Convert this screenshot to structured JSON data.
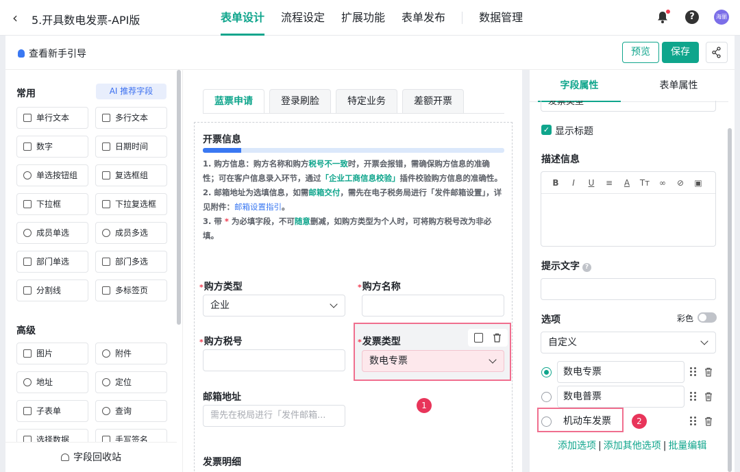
{
  "header": {
    "back_glyph": "‹",
    "title": "5.开具数电发票-API版",
    "tabs": [
      {
        "label": "表单设计",
        "active": true
      },
      {
        "label": "流程设定",
        "active": false
      },
      {
        "label": "扩展功能",
        "active": false
      },
      {
        "label": "表单发布",
        "active": false
      },
      {
        "label": "数据管理",
        "active": false
      }
    ],
    "help_glyph": "?",
    "avatar_text": "海丽"
  },
  "toolbar": {
    "guide_label": "查看新手引导",
    "preview_label": "预览",
    "save_label": "保存"
  },
  "left": {
    "common_title": "常用",
    "ai_label": "AI 推荐字段",
    "common_fields": [
      "单行文本",
      "多行文本",
      "数字",
      "日期时间",
      "单选按钮组",
      "复选框组",
      "下拉框",
      "下拉复选框",
      "成员单选",
      "成员多选",
      "部门单选",
      "部门多选",
      "分割线",
      "多标签页"
    ],
    "advanced_title": "高级",
    "advanced_fields": [
      "图片",
      "附件",
      "地址",
      "定位",
      "子表单",
      "查询",
      "选择数据",
      "手写签名"
    ],
    "recycle_label": "字段回收站"
  },
  "canvas": {
    "tabs": [
      "蓝票申请",
      "登录刷脸",
      "特定业务",
      "差额开票"
    ],
    "section_title": "开票信息",
    "info": {
      "l1a": "1. 购方信息：购方名称和购方",
      "l1b": "税号不一致",
      "l1c": "时，开票会报错，需确保购方信息的准确性；可在客户信息录入环节，通过",
      "l1d": "「企业工商信息校验」",
      "l1e": "插件校验购方信息的准确性。",
      "l2a": "2. 邮箱地址为选填信息，如需",
      "l2b": "邮箱交付",
      "l2c": "，需先在电子税务局进行「发件邮箱设置」，详见附件：",
      "l2d": "邮箱设置指引",
      "l2e": "。",
      "l3a": "3. 带",
      "l3b": " * ",
      "l3c": "为必填字段，不可",
      "l3d": "随意",
      "l3e": "删减，如购方类型为个人时，可将购方税号改为非必填。"
    },
    "required_mark": "*",
    "buyer_type_label": "购方类型",
    "buyer_type_value": "企业",
    "buyer_name_label": "购方名称",
    "buyer_tax_label": "购方税号",
    "invoice_type_label": "发票类型",
    "invoice_type_value": "数电专票",
    "email_label": "邮箱地址",
    "email_placeholder": "需先在税局进行「发件邮箱...",
    "detail_title": "发票明细",
    "badge1": "1"
  },
  "right": {
    "tabs": [
      "字段属性",
      "表单属性"
    ],
    "cut_value": "发票类型",
    "show_title_label": "显示标题",
    "desc_label": "描述信息",
    "hint_label": "提示文字",
    "options_label": "选项",
    "color_label": "彩色",
    "option_source": "自定义",
    "options": [
      {
        "label": "数电专票",
        "selected": true
      },
      {
        "label": "数电普票",
        "selected": false
      },
      {
        "label": "机动车发票",
        "selected": false
      }
    ],
    "badge2": "2",
    "link_add": "添加选项",
    "link_add_other": "添加其他选项",
    "link_batch": "批量编辑",
    "link_sep": "|"
  },
  "colors": {
    "accent": "#0fa58c",
    "highlight": "#f06e8e",
    "badge": "#e8355a",
    "link": "#3a78f2"
  }
}
